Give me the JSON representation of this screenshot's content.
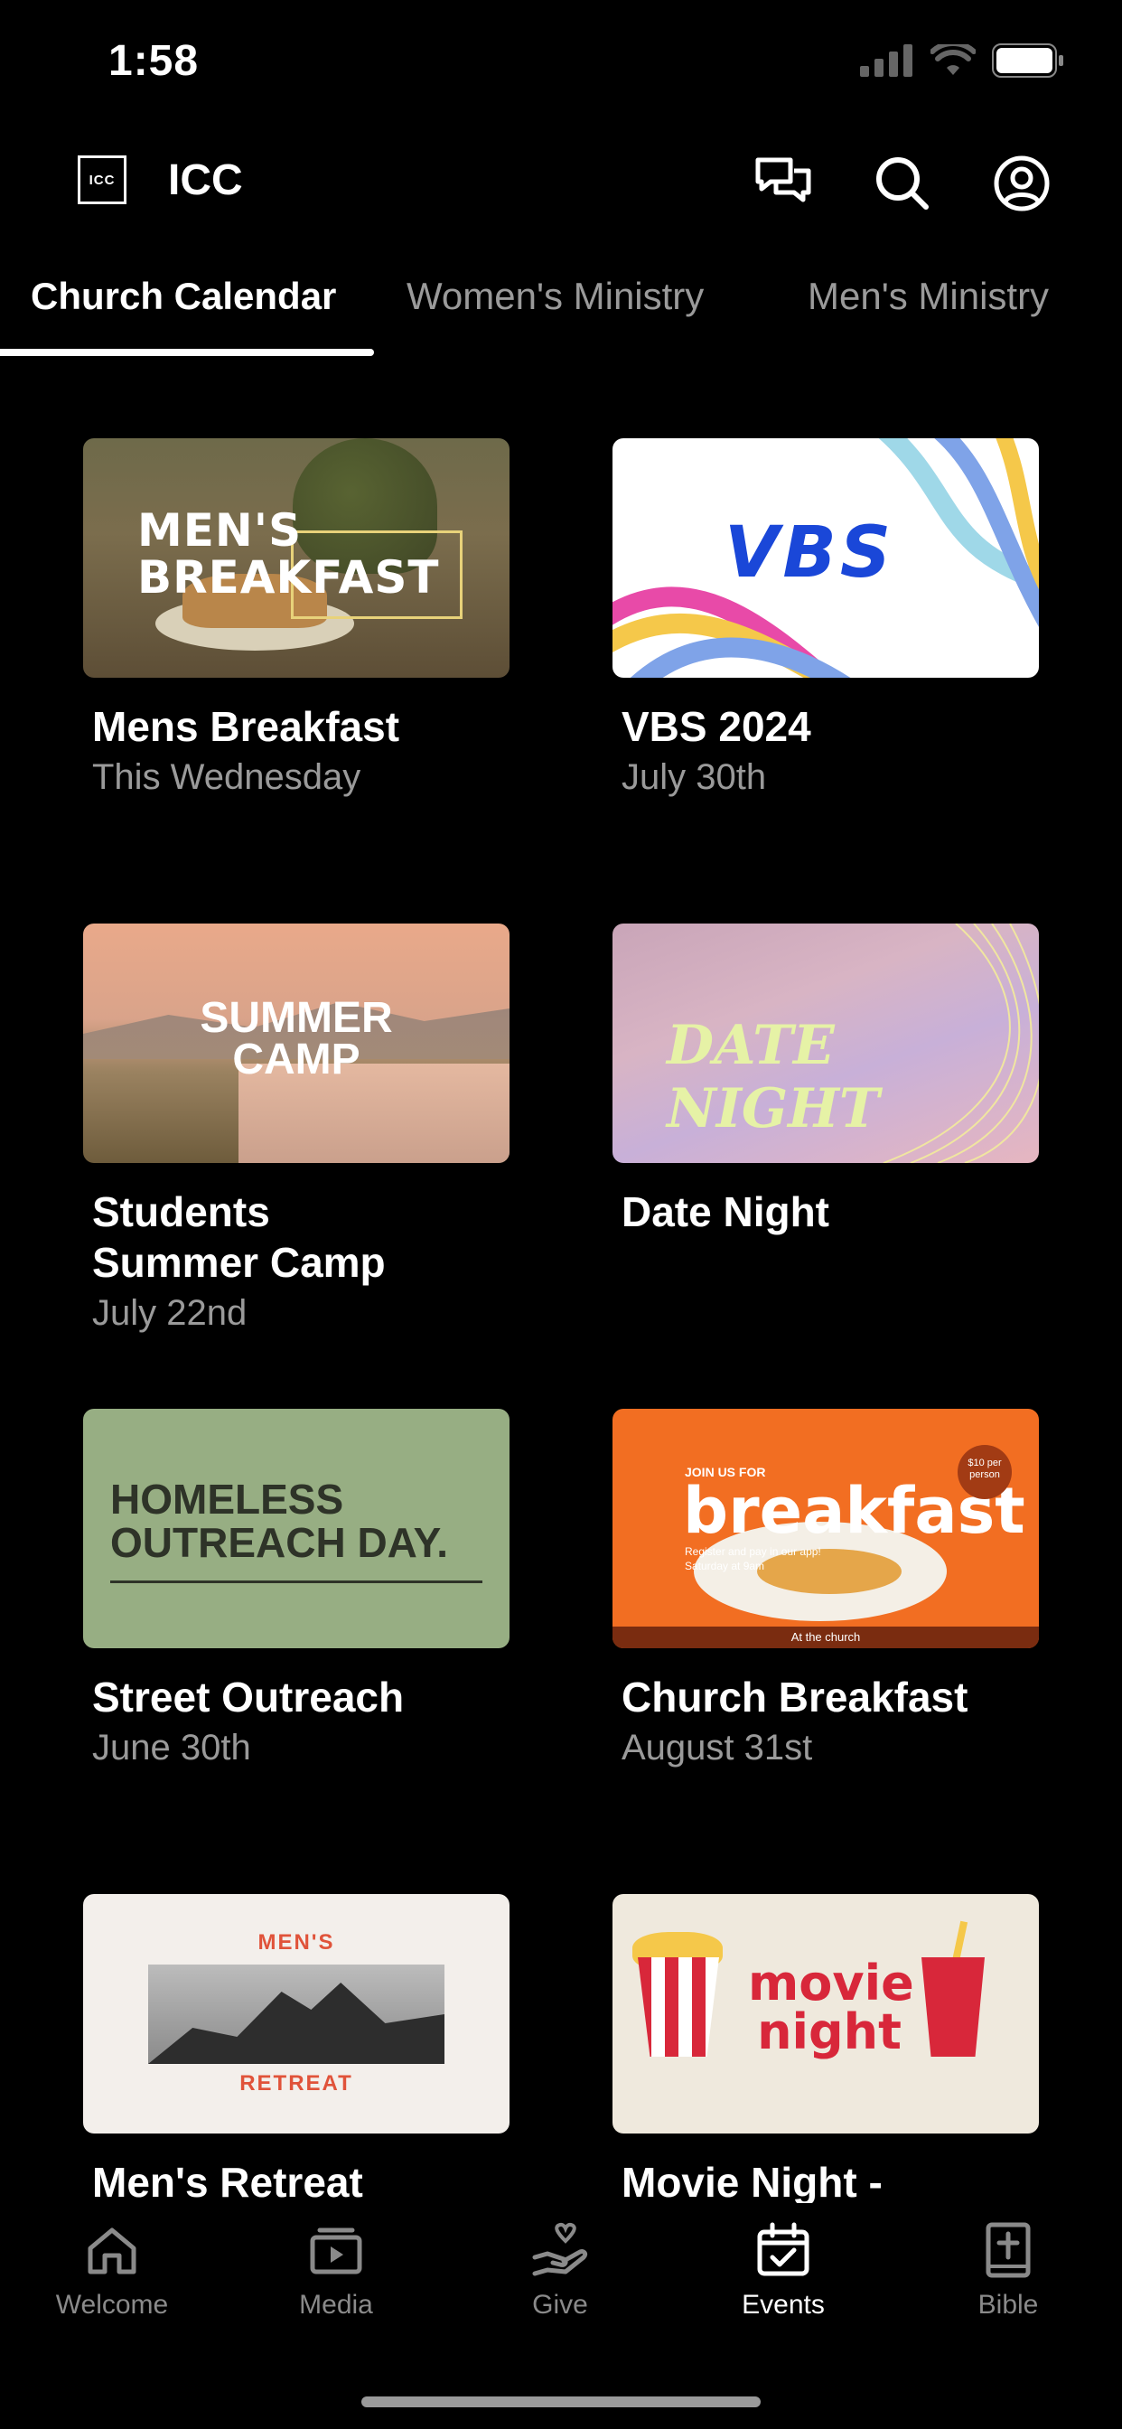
{
  "status_bar": {
    "time": "1:58"
  },
  "header": {
    "logo_text": "ICC",
    "app_name": "ICC"
  },
  "tabs": [
    {
      "label": "Church Calendar",
      "active": true
    },
    {
      "label": "Women's Ministry",
      "active": false
    },
    {
      "label": "Men's Ministry",
      "active": false
    }
  ],
  "events": [
    {
      "title": "Mens Breakfast",
      "date": "This Wednesday",
      "art_text_line1": "MEN'S",
      "art_text_line2": "BREAKFAST"
    },
    {
      "title": "VBS 2024",
      "date": "July 30th",
      "art_text": "VBS"
    },
    {
      "title": "Students\nSummer Camp",
      "date": "July 22nd",
      "art_text_line1": "SUMMER",
      "art_text_line2": "CAMP"
    },
    {
      "title": "Date Night",
      "date": "",
      "art_text": "DATE NIGHT"
    },
    {
      "title": "Street Outreach",
      "date": "June 30th",
      "art_text_line1": "HOMELESS",
      "art_text_line2": "OUTREACH DAY."
    },
    {
      "title": "Church Breakfast",
      "date": "August 31st",
      "art_kicker": "JOIN US FOR",
      "art_text": "breakfast",
      "art_sub_line1": "Register and pay in our app!",
      "art_sub_line2": "Saturday at 9am",
      "art_price": "$10 per person",
      "art_footer": "At the church"
    },
    {
      "title": "Men's Retreat",
      "date": "",
      "art_top": "MEN'S",
      "art_bottom": "RETREAT"
    },
    {
      "title": "Movie Night -",
      "date": "",
      "art_text_line1": "movie",
      "art_text_line2": "night"
    }
  ],
  "bottom_nav": [
    {
      "label": "Welcome",
      "icon": "home-icon",
      "active": false
    },
    {
      "label": "Media",
      "icon": "media-icon",
      "active": false
    },
    {
      "label": "Give",
      "icon": "give-icon",
      "active": false
    },
    {
      "label": "Events",
      "icon": "calendar-icon",
      "active": true
    },
    {
      "label": "Bible",
      "icon": "bible-icon",
      "active": false
    }
  ],
  "colors": {
    "background": "#000000",
    "text": "#ffffff",
    "muted": "#9a9a9a"
  }
}
